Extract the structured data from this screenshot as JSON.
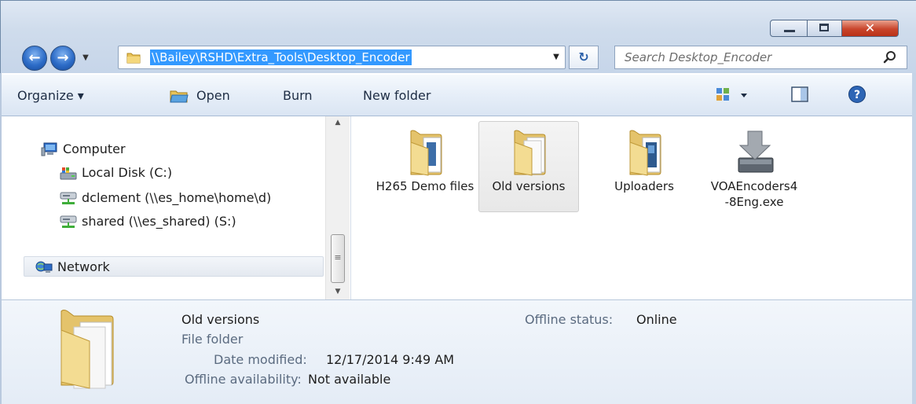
{
  "window": {
    "colors": {
      "accent": "#3399ff",
      "close": "#c9452c",
      "frame": "#cfdcec"
    }
  },
  "icons": {
    "back": "back-arrow-icon",
    "forward": "forward-arrow-icon",
    "recent": "chevron-down-icon",
    "folder": "folder-icon",
    "refresh": "refresh-icon",
    "search": "search-icon",
    "views": "view-options-icon",
    "preview": "preview-pane-icon",
    "help": "help-icon"
  },
  "address": {
    "path": "\\\\Bailey\\RSHD\\Extra_Tools\\Desktop_Encoder"
  },
  "search": {
    "placeholder": "Search Desktop_Encoder"
  },
  "toolbar": {
    "organize_label": "Organize ▾",
    "open_label": "Open",
    "burn_label": "Burn",
    "new_folder_label": "New folder"
  },
  "nav": {
    "items": [
      {
        "label": "Computer",
        "icon": "computer-icon"
      },
      {
        "label": "Local Disk (C:)",
        "icon": "local-disk-icon"
      },
      {
        "label": "dclement (\\\\es_home\\home\\d)",
        "icon": "network-drive-icon"
      },
      {
        "label": "shared (\\\\es_shared) (S:)",
        "icon": "network-drive-icon"
      },
      {
        "label": "Network",
        "icon": "network-icon"
      }
    ]
  },
  "files": [
    {
      "name": "H265 Demo files",
      "type": "folder",
      "selected": false
    },
    {
      "name": "Old versions",
      "type": "folder",
      "selected": true
    },
    {
      "name": "Uploaders",
      "type": "folder",
      "selected": false
    },
    {
      "name": "VOAEncoders4-8Eng.exe",
      "type": "installer",
      "selected": false
    }
  ],
  "details": {
    "name": "Old versions",
    "type": "File folder",
    "date_label": "Date modified:",
    "date_value": "12/17/2014 9:49 AM",
    "availability_label": "Offline availability:",
    "availability_value": "Not available",
    "status_label": "Offline status:",
    "status_value": "Online"
  }
}
